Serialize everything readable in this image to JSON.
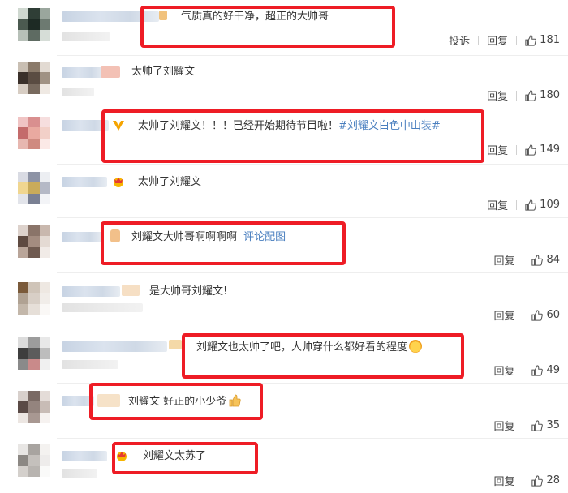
{
  "comments": [
    {
      "text": "气质真的好干净，超正的大帅哥",
      "report": "投诉",
      "reply": "回复",
      "likes": "181"
    },
    {
      "text": "太帅了刘耀文",
      "reply": "回复",
      "likes": "180"
    },
    {
      "text": "太帅了刘耀文！！！已经开始期待节目啦！",
      "hashtag": "#刘耀文白色中山装#",
      "reply": "回复",
      "likes": "149"
    },
    {
      "text": "太帅了刘耀文",
      "reply": "回复",
      "likes": "109"
    },
    {
      "text": "刘耀文大帅哥啊啊啊啊",
      "link": "评论配图",
      "reply": "回复",
      "likes": "84"
    },
    {
      "text": "是大帅哥刘耀文!",
      "reply": "回复",
      "likes": "60"
    },
    {
      "text": "刘耀文也太帅了吧，人帅穿什么都好看的程度",
      "reply": "回复",
      "likes": "49"
    },
    {
      "text": "刘耀文 好正的小少爷",
      "reply": "回复",
      "likes": "35"
    },
    {
      "text": "刘耀文太苏了",
      "reply": "回复",
      "likes": "28"
    }
  ],
  "colors": {
    "highlight": "#ee1c25",
    "link": "#4a7fbf"
  },
  "icons": {
    "like": "thumbs-up-icon",
    "vip": "vip-v-icon",
    "crown": "crown-icon"
  }
}
